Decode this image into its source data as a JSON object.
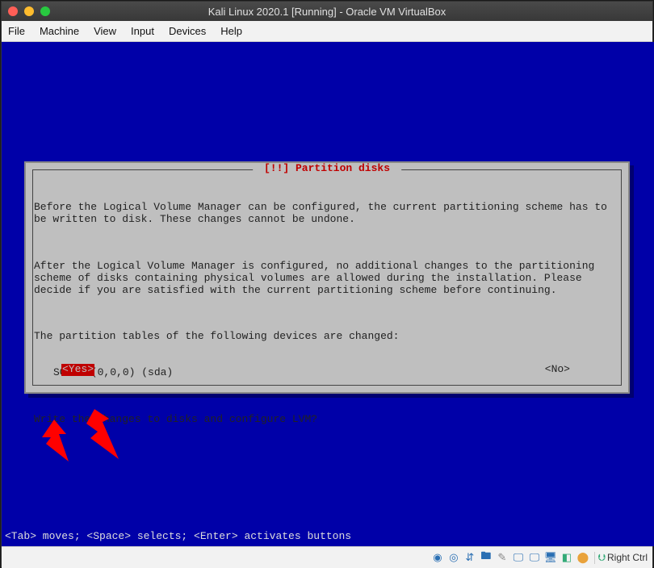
{
  "titlebar": {
    "title": "Kali Linux 2020.1 [Running] - Oracle VM VirtualBox"
  },
  "menubar": {
    "items": [
      "File",
      "Machine",
      "View",
      "Input",
      "Devices",
      "Help"
    ]
  },
  "dialog": {
    "title": " [!!] Partition disks ",
    "para1": "Before the Logical Volume Manager can be configured, the current partitioning scheme has to be written to disk. These changes cannot be undone.",
    "para2": "After the Logical Volume Manager is configured, no additional changes to the partitioning scheme of disks containing physical volumes are allowed during the installation. Please decide if you are satisfied with the current partitioning scheme before continuing.",
    "para3": "The partition tables of the following devices are changed:",
    "device": "SCSI2 (0,0,0) (sda)",
    "question": "Write the changes to disks and configure LVM?",
    "yes": "<Yes>",
    "no": "<No>"
  },
  "hint": "<Tab> moves; <Space> selects; <Enter> activates buttons",
  "statusbar": {
    "hostkey": "Right Ctrl"
  }
}
